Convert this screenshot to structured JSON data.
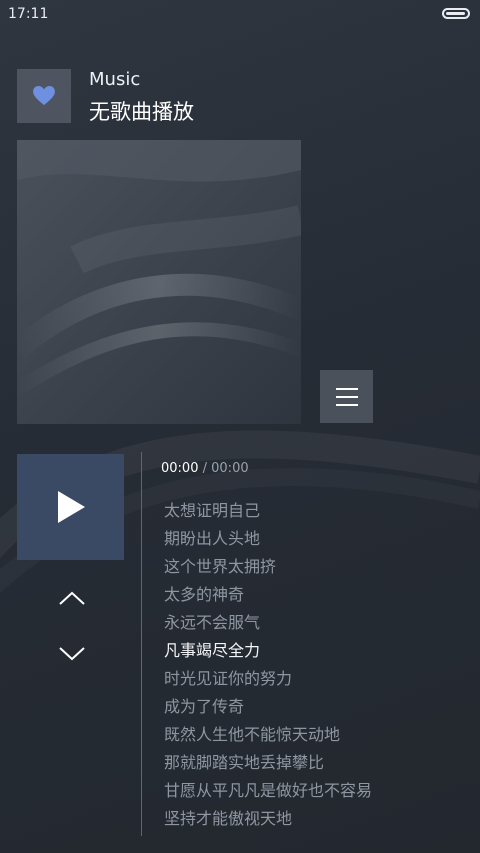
{
  "status_bar": {
    "time": "17:11",
    "battery_level_fraction": 0.85
  },
  "header": {
    "app_name": "Music",
    "song_status": "无歌曲播放"
  },
  "player": {
    "time_current": "00:00",
    "time_separator": "/",
    "time_total": "00:00"
  },
  "lyrics": [
    "太想证明自己",
    "期盼出人头地",
    "这个世界太拥挤",
    "太多的神奇",
    "永远不会服气",
    "凡事竭尽全力",
    "时光见证你的努力",
    "成为了传奇",
    "既然人生他不能惊天动地",
    "那就脚踏实地丢掉攀比",
    "甘愿从平凡凡是做好也不容易",
    "坚持才能傲视天地"
  ],
  "active_lyric_index": 5,
  "icons": {
    "favorite": "heart-icon",
    "menu": "menu-icon",
    "play": "play-icon",
    "previous": "chevron-up-icon",
    "next": "chevron-down-icon"
  },
  "colors": {
    "heart": "#6f8fe0",
    "play_button_bg": "#3b4a64",
    "background": "#2a3038"
  }
}
